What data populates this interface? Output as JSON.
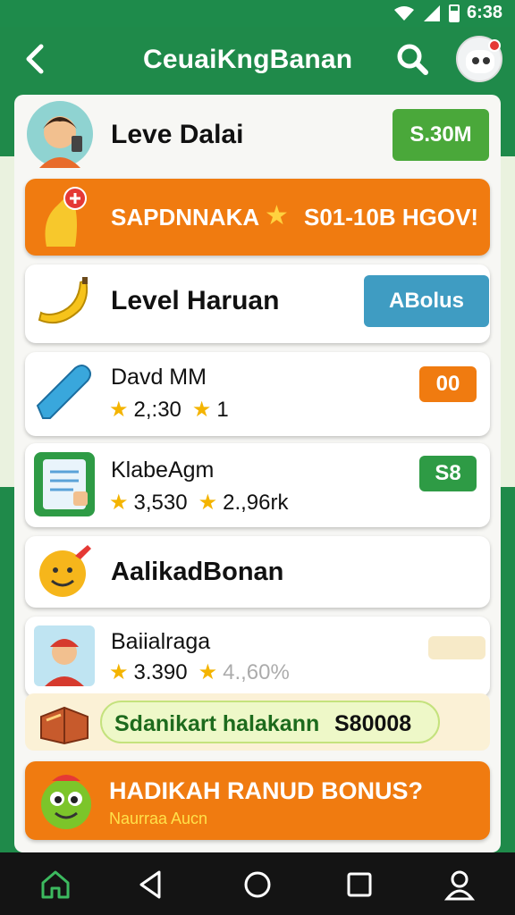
{
  "status": {
    "time": "6:38"
  },
  "app": {
    "title": "CeuaiKngBanan"
  },
  "header_row": {
    "title": "Leve Dalai",
    "button": "S.30M"
  },
  "promo": {
    "left": "SAPDNNAKA",
    "right": "S01-10B HGOV!"
  },
  "level_row": {
    "title": "Level Haruan",
    "button": "ABolus"
  },
  "rows": [
    {
      "title": "Davd MM",
      "stat1": "2,:30",
      "stat2": "1",
      "button": "00"
    },
    {
      "title": "KlabeAgm",
      "stat1": "3,530",
      "stat2": "2.,96rk",
      "button": "S8"
    },
    {
      "title": "AalikadBonan"
    },
    {
      "title": "Baiialraga",
      "stat1": "3.390",
      "stat2": "4.,60%",
      "button": ""
    }
  ],
  "pill": {
    "text": "Sdanikart halakann",
    "amount": "S80008"
  },
  "bonus": {
    "title": "HADIKAH RANUD BONUS?",
    "subtitle": "Naurraa Aucn"
  },
  "colors": {
    "brand_green": "#1f8a4a",
    "orange": "#f07b10",
    "button_green": "#4aa83a",
    "button_blue": "#3f9cc2"
  },
  "icons": [
    "back-arrow-icon",
    "search-icon",
    "avatar-icon",
    "banana-icon",
    "pencil-icon",
    "clipboard-icon",
    "emoji-icon",
    "book-icon",
    "mascot-icon",
    "home-icon",
    "back-nav-icon",
    "circle-home-icon",
    "recent-apps-icon",
    "profile-icon"
  ]
}
